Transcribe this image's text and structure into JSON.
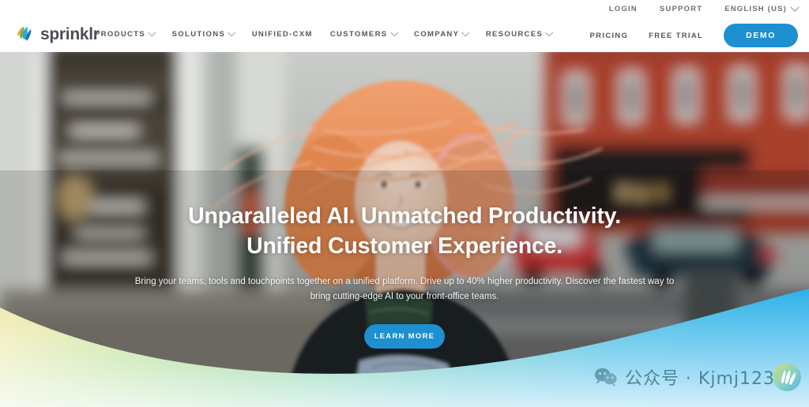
{
  "brand": {
    "name": "sprinklr",
    "logo_icon": "sprinklr-leaf-logo",
    "accent_blue": "#1e8fd1",
    "text_gray": "#53585e"
  },
  "header": {
    "utility_links": [
      {
        "label": "LOGIN",
        "icon": null
      },
      {
        "label": "SUPPORT",
        "icon": null
      }
    ],
    "language": {
      "label": "ENGLISH (US)",
      "icon": "chevron-down-icon"
    },
    "nav": [
      {
        "label": "PRODUCTS",
        "has_dropdown": true
      },
      {
        "label": "SOLUTIONS",
        "has_dropdown": true
      },
      {
        "label": "UNIFIED-CXM",
        "has_dropdown": false
      },
      {
        "label": "CUSTOMERS",
        "has_dropdown": true
      },
      {
        "label": "COMPANY",
        "has_dropdown": true
      },
      {
        "label": "RESOURCES",
        "has_dropdown": true
      }
    ],
    "actions": [
      {
        "label": "PRICING"
      },
      {
        "label": "FREE TRIAL"
      }
    ],
    "cta": {
      "label": "DEMO",
      "color": "#1e8fd1"
    }
  },
  "hero": {
    "title_line1": "Unparalleled AI. Unmatched Productivity.",
    "title_line2": "Unified Customer Experience.",
    "subtitle": "Bring your teams, tools and touchpoints together on a unified platform. Drive up to 40% higher productivity. Discover the fastest way to bring cutting-edge AI to your front-office teams.",
    "cta": {
      "label": "LEARN MORE",
      "color": "#1e8fd1"
    },
    "background_description": "Smiling woman with windblown red hair on a blurred city street"
  },
  "wave": {
    "gradient_stops": [
      "#e8c84a",
      "#cfd858",
      "#8dd06a",
      "#63c99a",
      "#35b8d8",
      "#2fb3e8"
    ]
  },
  "watermark": {
    "wechat_icon": "wechat-icon",
    "text": "公众号 · Kjmj123",
    "badge_icon": "sprinklr-leaf-badge"
  }
}
